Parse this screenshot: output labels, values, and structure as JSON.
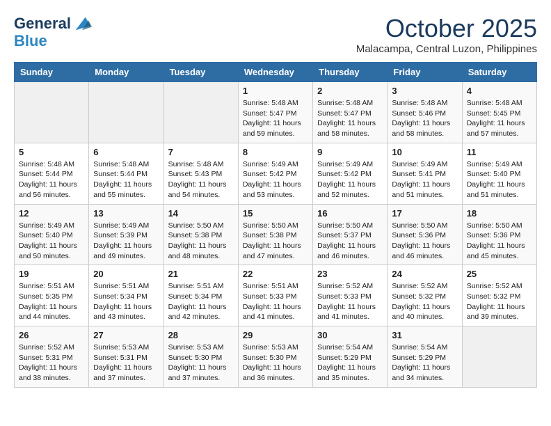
{
  "header": {
    "logo_line1": "General",
    "logo_line2": "Blue",
    "month": "October 2025",
    "location": "Malacampa, Central Luzon, Philippines"
  },
  "days_of_week": [
    "Sunday",
    "Monday",
    "Tuesday",
    "Wednesday",
    "Thursday",
    "Friday",
    "Saturday"
  ],
  "weeks": [
    [
      {
        "day": "",
        "empty": true
      },
      {
        "day": "",
        "empty": true
      },
      {
        "day": "",
        "empty": true
      },
      {
        "day": "1",
        "sunrise": "5:48 AM",
        "sunset": "5:47 PM",
        "daylight": "11 hours and 59 minutes."
      },
      {
        "day": "2",
        "sunrise": "5:48 AM",
        "sunset": "5:47 PM",
        "daylight": "11 hours and 58 minutes."
      },
      {
        "day": "3",
        "sunrise": "5:48 AM",
        "sunset": "5:46 PM",
        "daylight": "11 hours and 58 minutes."
      },
      {
        "day": "4",
        "sunrise": "5:48 AM",
        "sunset": "5:45 PM",
        "daylight": "11 hours and 57 minutes."
      }
    ],
    [
      {
        "day": "5",
        "sunrise": "5:48 AM",
        "sunset": "5:44 PM",
        "daylight": "11 hours and 56 minutes."
      },
      {
        "day": "6",
        "sunrise": "5:48 AM",
        "sunset": "5:44 PM",
        "daylight": "11 hours and 55 minutes."
      },
      {
        "day": "7",
        "sunrise": "5:48 AM",
        "sunset": "5:43 PM",
        "daylight": "11 hours and 54 minutes."
      },
      {
        "day": "8",
        "sunrise": "5:49 AM",
        "sunset": "5:42 PM",
        "daylight": "11 hours and 53 minutes."
      },
      {
        "day": "9",
        "sunrise": "5:49 AM",
        "sunset": "5:42 PM",
        "daylight": "11 hours and 52 minutes."
      },
      {
        "day": "10",
        "sunrise": "5:49 AM",
        "sunset": "5:41 PM",
        "daylight": "11 hours and 51 minutes."
      },
      {
        "day": "11",
        "sunrise": "5:49 AM",
        "sunset": "5:40 PM",
        "daylight": "11 hours and 51 minutes."
      }
    ],
    [
      {
        "day": "12",
        "sunrise": "5:49 AM",
        "sunset": "5:40 PM",
        "daylight": "11 hours and 50 minutes."
      },
      {
        "day": "13",
        "sunrise": "5:49 AM",
        "sunset": "5:39 PM",
        "daylight": "11 hours and 49 minutes."
      },
      {
        "day": "14",
        "sunrise": "5:50 AM",
        "sunset": "5:38 PM",
        "daylight": "11 hours and 48 minutes."
      },
      {
        "day": "15",
        "sunrise": "5:50 AM",
        "sunset": "5:38 PM",
        "daylight": "11 hours and 47 minutes."
      },
      {
        "day": "16",
        "sunrise": "5:50 AM",
        "sunset": "5:37 PM",
        "daylight": "11 hours and 46 minutes."
      },
      {
        "day": "17",
        "sunrise": "5:50 AM",
        "sunset": "5:36 PM",
        "daylight": "11 hours and 46 minutes."
      },
      {
        "day": "18",
        "sunrise": "5:50 AM",
        "sunset": "5:36 PM",
        "daylight": "11 hours and 45 minutes."
      }
    ],
    [
      {
        "day": "19",
        "sunrise": "5:51 AM",
        "sunset": "5:35 PM",
        "daylight": "11 hours and 44 minutes."
      },
      {
        "day": "20",
        "sunrise": "5:51 AM",
        "sunset": "5:34 PM",
        "daylight": "11 hours and 43 minutes."
      },
      {
        "day": "21",
        "sunrise": "5:51 AM",
        "sunset": "5:34 PM",
        "daylight": "11 hours and 42 minutes."
      },
      {
        "day": "22",
        "sunrise": "5:51 AM",
        "sunset": "5:33 PM",
        "daylight": "11 hours and 41 minutes."
      },
      {
        "day": "23",
        "sunrise": "5:52 AM",
        "sunset": "5:33 PM",
        "daylight": "11 hours and 41 minutes."
      },
      {
        "day": "24",
        "sunrise": "5:52 AM",
        "sunset": "5:32 PM",
        "daylight": "11 hours and 40 minutes."
      },
      {
        "day": "25",
        "sunrise": "5:52 AM",
        "sunset": "5:32 PM",
        "daylight": "11 hours and 39 minutes."
      }
    ],
    [
      {
        "day": "26",
        "sunrise": "5:52 AM",
        "sunset": "5:31 PM",
        "daylight": "11 hours and 38 minutes."
      },
      {
        "day": "27",
        "sunrise": "5:53 AM",
        "sunset": "5:31 PM",
        "daylight": "11 hours and 37 minutes."
      },
      {
        "day": "28",
        "sunrise": "5:53 AM",
        "sunset": "5:30 PM",
        "daylight": "11 hours and 37 minutes."
      },
      {
        "day": "29",
        "sunrise": "5:53 AM",
        "sunset": "5:30 PM",
        "daylight": "11 hours and 36 minutes."
      },
      {
        "day": "30",
        "sunrise": "5:54 AM",
        "sunset": "5:29 PM",
        "daylight": "11 hours and 35 minutes."
      },
      {
        "day": "31",
        "sunrise": "5:54 AM",
        "sunset": "5:29 PM",
        "daylight": "11 hours and 34 minutes."
      },
      {
        "day": "",
        "empty": true
      }
    ]
  ]
}
